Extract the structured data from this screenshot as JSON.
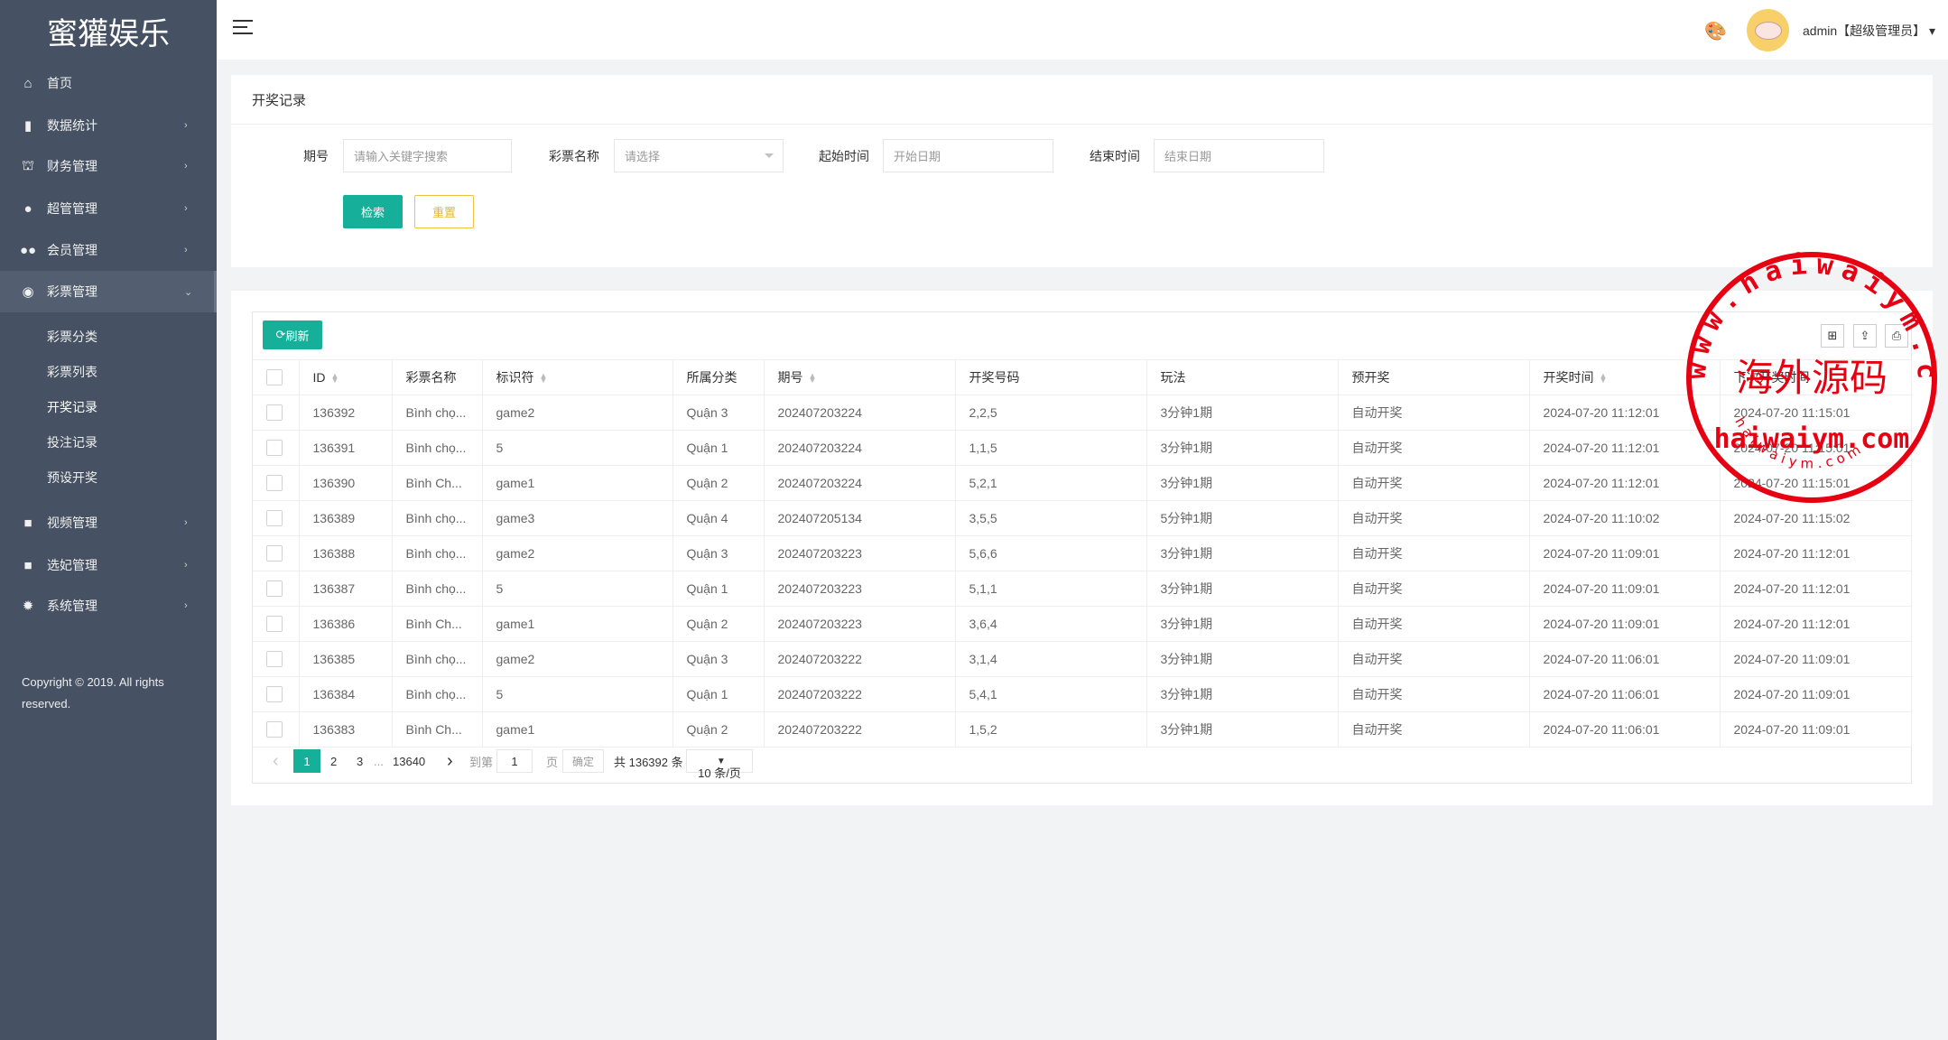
{
  "app": {
    "logo": "蜜獾娱乐",
    "copyright": "Copyright © 2019. All rights reserved."
  },
  "sidebar": {
    "items": [
      {
        "label": "首页",
        "icon": "home-icon",
        "glyph": "⌂",
        "chevron": ""
      },
      {
        "label": "数据统计",
        "icon": "bar-chart-icon",
        "glyph": "▮",
        "chevron": "›"
      },
      {
        "label": "财务管理",
        "icon": "bank-icon",
        "glyph": "⛫",
        "chevron": "›"
      },
      {
        "label": "超管管理",
        "icon": "user-icon",
        "glyph": "●",
        "chevron": "›"
      },
      {
        "label": "会员管理",
        "icon": "users-icon",
        "glyph": "●●",
        "chevron": "›"
      },
      {
        "label": "彩票管理",
        "icon": "gamepad-icon",
        "glyph": "◉",
        "chevron": "⌄"
      },
      {
        "label": "视频管理",
        "icon": "video-icon",
        "glyph": "■",
        "chevron": "›"
      },
      {
        "label": "选妃管理",
        "icon": "video-icon",
        "glyph": "■",
        "chevron": "›"
      },
      {
        "label": "系统管理",
        "icon": "gear-icon",
        "glyph": "✹",
        "chevron": "›"
      }
    ],
    "subitems": [
      "彩票分类",
      "彩票列表",
      "开奖记录",
      "投注记录",
      "预设开奖"
    ]
  },
  "header": {
    "user": "admin【超级管理员】",
    "caret": "▾",
    "palette_icon": "palette-icon"
  },
  "filters": {
    "title": "开奖记录",
    "period_label": "期号",
    "period_placeholder": "请输入关键字搜索",
    "lottery_label": "彩票名称",
    "lottery_placeholder": "请选择",
    "start_label": "起始时间",
    "start_placeholder": "开始日期",
    "end_label": "结束时间",
    "end_placeholder": "结束日期",
    "search": "检索",
    "reset": "重置"
  },
  "table": {
    "refresh": "刷新",
    "tools": [
      "⊞",
      "⇪",
      "⎙"
    ],
    "columns": [
      "ID",
      "彩票名称",
      "标识符",
      "所属分类",
      "期号",
      "开奖号码",
      "玩法",
      "预开奖",
      "开奖时间",
      "下次开奖时间"
    ],
    "rows": [
      [
        "136392",
        "Bình chọ...",
        "game2",
        "Quận 3",
        "202407203224",
        "2,2,5",
        "3分钟1期",
        "自动开奖",
        "2024-07-20 11:12:01",
        "2024-07-20 11:15:01"
      ],
      [
        "136391",
        "Bình chọ...",
        "5",
        "Quận 1",
        "202407203224",
        "1,1,5",
        "3分钟1期",
        "自动开奖",
        "2024-07-20 11:12:01",
        "2024-07-20 11:15:01"
      ],
      [
        "136390",
        "Bình Ch...",
        "game1",
        "Quận 2",
        "202407203224",
        "5,2,1",
        "3分钟1期",
        "自动开奖",
        "2024-07-20 11:12:01",
        "2024-07-20 11:15:01"
      ],
      [
        "136389",
        "Bình chọ...",
        "game3",
        "Quận 4",
        "202407205134",
        "3,5,5",
        "5分钟1期",
        "自动开奖",
        "2024-07-20 11:10:02",
        "2024-07-20 11:15:02"
      ],
      [
        "136388",
        "Bình chọ...",
        "game2",
        "Quận 3",
        "202407203223",
        "5,6,6",
        "3分钟1期",
        "自动开奖",
        "2024-07-20 11:09:01",
        "2024-07-20 11:12:01"
      ],
      [
        "136387",
        "Bình chọ...",
        "5",
        "Quận 1",
        "202407203223",
        "5,1,1",
        "3分钟1期",
        "自动开奖",
        "2024-07-20 11:09:01",
        "2024-07-20 11:12:01"
      ],
      [
        "136386",
        "Bình Ch...",
        "game1",
        "Quận 2",
        "202407203223",
        "3,6,4",
        "3分钟1期",
        "自动开奖",
        "2024-07-20 11:09:01",
        "2024-07-20 11:12:01"
      ],
      [
        "136385",
        "Bình chọ...",
        "game2",
        "Quận 3",
        "202407203222",
        "3,1,4",
        "3分钟1期",
        "自动开奖",
        "2024-07-20 11:06:01",
        "2024-07-20 11:09:01"
      ],
      [
        "136384",
        "Bình chọ...",
        "5",
        "Quận 1",
        "202407203222",
        "5,4,1",
        "3分钟1期",
        "自动开奖",
        "2024-07-20 11:06:01",
        "2024-07-20 11:09:01"
      ],
      [
        "136383",
        "Bình Ch...",
        "game1",
        "Quận 2",
        "202407203222",
        "1,5,2",
        "3分钟1期",
        "自动开奖",
        "2024-07-20 11:06:01",
        "2024-07-20 11:09:01"
      ]
    ]
  },
  "pagination": {
    "prev": "‹",
    "pages": [
      "1",
      "2",
      "3"
    ],
    "ellipsis": "...",
    "last": "13640",
    "next": "›",
    "goto_label": "到第",
    "goto_value": "1",
    "page_unit": "页",
    "confirm": "确定",
    "total": "共 136392 条",
    "page_size": "10 条/页"
  },
  "watermark": {
    "ring_text": "www.haiwaiym.com",
    "center_text": "海外源码",
    "domain_text": "haiwaiym.com",
    "bottom_text": "haiwaiym.com",
    "color": "#e60012"
  },
  "colors": {
    "sidebar": "#465263",
    "accent": "#16b09a",
    "warning": "#f0c040"
  }
}
